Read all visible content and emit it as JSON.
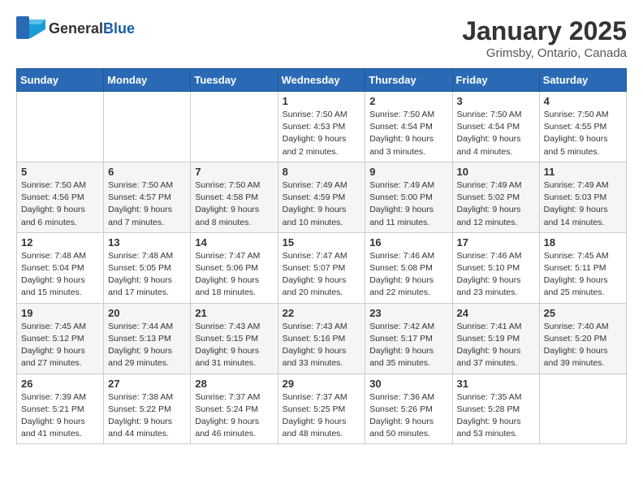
{
  "header": {
    "logo": {
      "general": "General",
      "blue": "Blue"
    },
    "title": "January 2025",
    "location": "Grimsby, Ontario, Canada"
  },
  "calendar": {
    "days_of_week": [
      "Sunday",
      "Monday",
      "Tuesday",
      "Wednesday",
      "Thursday",
      "Friday",
      "Saturday"
    ],
    "weeks": [
      [
        {
          "day": "",
          "info": ""
        },
        {
          "day": "",
          "info": ""
        },
        {
          "day": "",
          "info": ""
        },
        {
          "day": "1",
          "info": "Sunrise: 7:50 AM\nSunset: 4:53 PM\nDaylight: 9 hours and 2 minutes."
        },
        {
          "day": "2",
          "info": "Sunrise: 7:50 AM\nSunset: 4:54 PM\nDaylight: 9 hours and 3 minutes."
        },
        {
          "day": "3",
          "info": "Sunrise: 7:50 AM\nSunset: 4:54 PM\nDaylight: 9 hours and 4 minutes."
        },
        {
          "day": "4",
          "info": "Sunrise: 7:50 AM\nSunset: 4:55 PM\nDaylight: 9 hours and 5 minutes."
        }
      ],
      [
        {
          "day": "5",
          "info": "Sunrise: 7:50 AM\nSunset: 4:56 PM\nDaylight: 9 hours and 6 minutes."
        },
        {
          "day": "6",
          "info": "Sunrise: 7:50 AM\nSunset: 4:57 PM\nDaylight: 9 hours and 7 minutes."
        },
        {
          "day": "7",
          "info": "Sunrise: 7:50 AM\nSunset: 4:58 PM\nDaylight: 9 hours and 8 minutes."
        },
        {
          "day": "8",
          "info": "Sunrise: 7:49 AM\nSunset: 4:59 PM\nDaylight: 9 hours and 10 minutes."
        },
        {
          "day": "9",
          "info": "Sunrise: 7:49 AM\nSunset: 5:00 PM\nDaylight: 9 hours and 11 minutes."
        },
        {
          "day": "10",
          "info": "Sunrise: 7:49 AM\nSunset: 5:02 PM\nDaylight: 9 hours and 12 minutes."
        },
        {
          "day": "11",
          "info": "Sunrise: 7:49 AM\nSunset: 5:03 PM\nDaylight: 9 hours and 14 minutes."
        }
      ],
      [
        {
          "day": "12",
          "info": "Sunrise: 7:48 AM\nSunset: 5:04 PM\nDaylight: 9 hours and 15 minutes."
        },
        {
          "day": "13",
          "info": "Sunrise: 7:48 AM\nSunset: 5:05 PM\nDaylight: 9 hours and 17 minutes."
        },
        {
          "day": "14",
          "info": "Sunrise: 7:47 AM\nSunset: 5:06 PM\nDaylight: 9 hours and 18 minutes."
        },
        {
          "day": "15",
          "info": "Sunrise: 7:47 AM\nSunset: 5:07 PM\nDaylight: 9 hours and 20 minutes."
        },
        {
          "day": "16",
          "info": "Sunrise: 7:46 AM\nSunset: 5:08 PM\nDaylight: 9 hours and 22 minutes."
        },
        {
          "day": "17",
          "info": "Sunrise: 7:46 AM\nSunset: 5:10 PM\nDaylight: 9 hours and 23 minutes."
        },
        {
          "day": "18",
          "info": "Sunrise: 7:45 AM\nSunset: 5:11 PM\nDaylight: 9 hours and 25 minutes."
        }
      ],
      [
        {
          "day": "19",
          "info": "Sunrise: 7:45 AM\nSunset: 5:12 PM\nDaylight: 9 hours and 27 minutes."
        },
        {
          "day": "20",
          "info": "Sunrise: 7:44 AM\nSunset: 5:13 PM\nDaylight: 9 hours and 29 minutes."
        },
        {
          "day": "21",
          "info": "Sunrise: 7:43 AM\nSunset: 5:15 PM\nDaylight: 9 hours and 31 minutes."
        },
        {
          "day": "22",
          "info": "Sunrise: 7:43 AM\nSunset: 5:16 PM\nDaylight: 9 hours and 33 minutes."
        },
        {
          "day": "23",
          "info": "Sunrise: 7:42 AM\nSunset: 5:17 PM\nDaylight: 9 hours and 35 minutes."
        },
        {
          "day": "24",
          "info": "Sunrise: 7:41 AM\nSunset: 5:19 PM\nDaylight: 9 hours and 37 minutes."
        },
        {
          "day": "25",
          "info": "Sunrise: 7:40 AM\nSunset: 5:20 PM\nDaylight: 9 hours and 39 minutes."
        }
      ],
      [
        {
          "day": "26",
          "info": "Sunrise: 7:39 AM\nSunset: 5:21 PM\nDaylight: 9 hours and 41 minutes."
        },
        {
          "day": "27",
          "info": "Sunrise: 7:38 AM\nSunset: 5:22 PM\nDaylight: 9 hours and 44 minutes."
        },
        {
          "day": "28",
          "info": "Sunrise: 7:37 AM\nSunset: 5:24 PM\nDaylight: 9 hours and 46 minutes."
        },
        {
          "day": "29",
          "info": "Sunrise: 7:37 AM\nSunset: 5:25 PM\nDaylight: 9 hours and 48 minutes."
        },
        {
          "day": "30",
          "info": "Sunrise: 7:36 AM\nSunset: 5:26 PM\nDaylight: 9 hours and 50 minutes."
        },
        {
          "day": "31",
          "info": "Sunrise: 7:35 AM\nSunset: 5:28 PM\nDaylight: 9 hours and 53 minutes."
        },
        {
          "day": "",
          "info": ""
        }
      ]
    ]
  }
}
